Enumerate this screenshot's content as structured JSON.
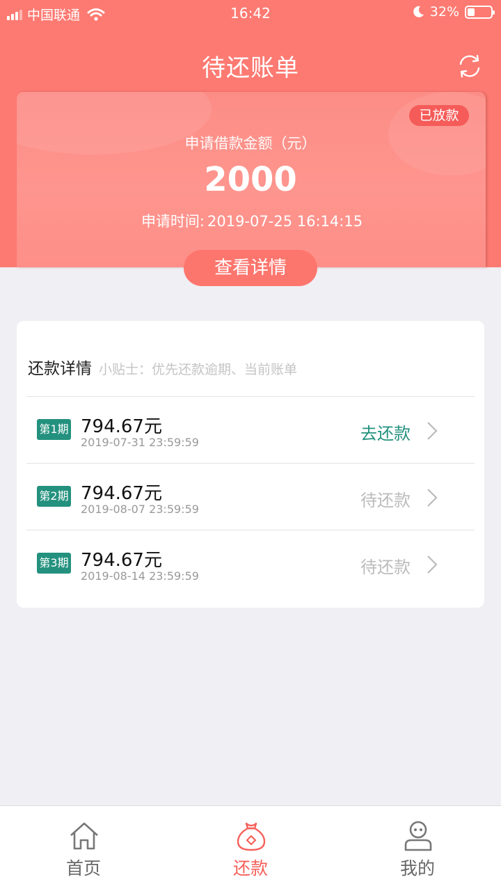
{
  "status_bar": {
    "carrier": "中国联通",
    "time": "16:42",
    "battery": "32%",
    "battery_level": 0.32
  },
  "header": {
    "title": "待还账单"
  },
  "loan": {
    "badge": "已放款",
    "amount_label": "申请借款金额（元）",
    "amount": "2000",
    "time_label": "申请时间:",
    "time_value": "2019-07-25 16:14:15",
    "detail_button": "查看详情"
  },
  "repayment": {
    "title": "还款详情",
    "tip": "小贴士：优先还款逾期、当前账单",
    "items": [
      {
        "period": "第1期",
        "amount": "794.67元",
        "due": "2019-07-31 23:59:59",
        "status": "去还款"
      },
      {
        "period": "第2期",
        "amount": "794.67元",
        "due": "2019-08-07 23:59:59",
        "status": "待还款"
      },
      {
        "period": "第3期",
        "amount": "794.67元",
        "due": "2019-08-14 23:59:59",
        "status": "待还款"
      }
    ]
  },
  "tabbar": {
    "items": [
      {
        "label": "首页",
        "icon": "home-icon"
      },
      {
        "label": "还款",
        "icon": "money-bag-icon"
      },
      {
        "label": "我的",
        "icon": "profile-icon"
      }
    ],
    "active_index": 1
  },
  "colors": {
    "header": "#fd7a72",
    "accent_green": "#23917e",
    "active_tab": "#f5605a"
  }
}
